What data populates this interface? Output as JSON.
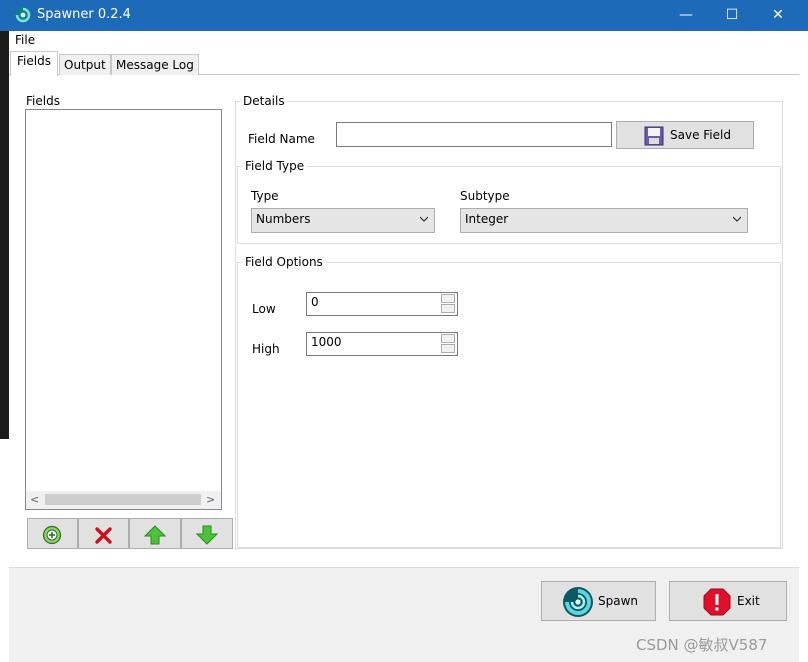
{
  "window": {
    "title": "Spawner 0.2.4",
    "minimize": "—",
    "maximize": "☐",
    "close": "✕"
  },
  "menu": {
    "file": "File"
  },
  "tabs": [
    "Fields",
    "Output",
    "Message Log"
  ],
  "fields_panel": {
    "label": "Fields",
    "items": [],
    "scroll_left": "<",
    "scroll_right": ">"
  },
  "details": {
    "legend": "Details",
    "field_name_label": "Field Name",
    "field_name_value": "",
    "save_button": "Save Field"
  },
  "field_type": {
    "legend": "Field Type",
    "type_label": "Type",
    "type_value": "Numbers",
    "subtype_label": "Subtype",
    "subtype_value": "Integer"
  },
  "field_options": {
    "legend": "Field Options",
    "low_label": "Low",
    "low_value": "0",
    "high_label": "High",
    "high_value": "1000"
  },
  "footer": {
    "spawn_button": "Spawn",
    "exit_button": "Exit"
  },
  "watermark": "CSDN @敏叔V587",
  "icons": {
    "app": "spawner-swirl-icon",
    "add": "plus-circle-icon",
    "delete": "red-x-icon",
    "up": "green-up-arrow-icon",
    "down": "green-down-arrow-icon",
    "save": "floppy-disk-icon",
    "exit": "red-stop-icon"
  },
  "colors": {
    "titlebar": "#1c6ab8",
    "accent_green": "#3fae2a",
    "danger": "#e0102a"
  }
}
